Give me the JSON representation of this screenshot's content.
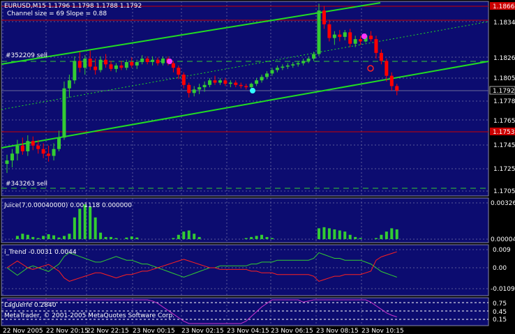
{
  "colors": {
    "background": "#000000",
    "plot_bg": "#0c0c70",
    "bull": "#33cc33",
    "bear": "#ff0000",
    "channel": "#22dd22",
    "hline": "#cc0000",
    "juice": "#33cc33",
    "trend_green": "#33cc33",
    "trend_red": "#ff2020",
    "laguerre": "#cc33cc"
  },
  "main": {
    "header_line1": "EURUSD,M15  1.1796 1.1798 1.1788 1.1792",
    "header_line2": "Channel size = 69 Slope = 0.88",
    "label_sell1": "#352209 sell",
    "label_sell2": "#343263 sell",
    "price_ticks": [
      "1.1834",
      "1.1805",
      "1.1778",
      "1.1765",
      "1.1745",
      "1.1725",
      "1.1705"
    ],
    "tag_top": "1.1866",
    "tag_current": "1.1792",
    "tag_low": "1.1753"
  },
  "juice": {
    "label": "Juice(7,0.00040000) 0.001118 0.000000",
    "ticks": [
      "0.00326",
      "0.00004"
    ]
  },
  "itrend": {
    "label": "i_Trend -0.0031 0.0044",
    "ticks": [
      "0.009",
      "0.00",
      "-0.0109"
    ]
  },
  "laguerre": {
    "label": "Laguerre 0.2840",
    "ticks": [
      "0.75",
      "0.45",
      "0.15"
    ],
    "copyright": "MetaTrader, © 2001-2005 MetaQuotes Software Corp."
  },
  "time_axis": [
    "22 Nov 2005",
    "22 Nov 20:15",
    "22 Nov 22:15",
    "23 Nov 00:15",
    "23 Nov 02:15",
    "23 Nov 04:15",
    "23 Nov 06:15",
    "23 Nov 08:15",
    "23 Nov 10:15"
  ],
  "chart_data": {
    "type": "candlestick",
    "symbol": "EURUSD",
    "timeframe": "M15",
    "ylim": [
      1.17,
      1.187
    ],
    "candles": [
      [
        1.1728,
        1.1736,
        1.172,
        1.1731
      ],
      [
        1.1731,
        1.1741,
        1.1725,
        1.1737
      ],
      [
        1.1737,
        1.1749,
        1.1731,
        1.1744
      ],
      [
        1.1744,
        1.1751,
        1.1736,
        1.1739
      ],
      [
        1.1739,
        1.1753,
        1.1735,
        1.1748
      ],
      [
        1.1748,
        1.1752,
        1.174,
        1.1744
      ],
      [
        1.1744,
        1.1749,
        1.1737,
        1.1741
      ],
      [
        1.1741,
        1.1746,
        1.1733,
        1.1737
      ],
      [
        1.1737,
        1.1744,
        1.173,
        1.1735
      ],
      [
        1.1735,
        1.1746,
        1.1731,
        1.1741
      ],
      [
        1.1741,
        1.1757,
        1.1739,
        1.1751
      ],
      [
        1.1751,
        1.18,
        1.1749,
        1.1794
      ],
      [
        1.1794,
        1.1806,
        1.1786,
        1.1801
      ],
      [
        1.1801,
        1.1822,
        1.1798,
        1.1818
      ],
      [
        1.1818,
        1.1826,
        1.1808,
        1.1812
      ],
      [
        1.1812,
        1.1823,
        1.1806,
        1.182
      ],
      [
        1.182,
        1.1827,
        1.181,
        1.1813
      ],
      [
        1.1813,
        1.182,
        1.1806,
        1.181
      ],
      [
        1.181,
        1.1822,
        1.1808,
        1.1819
      ],
      [
        1.1819,
        1.1824,
        1.1812,
        1.1815
      ],
      [
        1.1815,
        1.1818,
        1.1809,
        1.1811
      ],
      [
        1.1811,
        1.1816,
        1.1808,
        1.1814
      ],
      [
        1.1814,
        1.1818,
        1.181,
        1.1812
      ],
      [
        1.1812,
        1.1819,
        1.181,
        1.1817
      ],
      [
        1.1817,
        1.1821,
        1.1812,
        1.1814
      ],
      [
        1.1814,
        1.1819,
        1.1811,
        1.1817
      ],
      [
        1.1817,
        1.1823,
        1.1815,
        1.182
      ],
      [
        1.182,
        1.1822,
        1.1815,
        1.1817
      ],
      [
        1.1817,
        1.1822,
        1.1814,
        1.1819
      ],
      [
        1.1819,
        1.1821,
        1.1814,
        1.1816
      ],
      [
        1.1816,
        1.1822,
        1.1814,
        1.182
      ],
      [
        1.182,
        1.1822,
        1.1814,
        1.1816
      ],
      [
        1.1816,
        1.1818,
        1.1808,
        1.1812
      ],
      [
        1.1812,
        1.1814,
        1.1802,
        1.1806
      ],
      [
        1.1806,
        1.1808,
        1.1794,
        1.1797
      ],
      [
        1.1797,
        1.1799,
        1.1786,
        1.179
      ],
      [
        1.179,
        1.1796,
        1.1787,
        1.1793
      ],
      [
        1.1793,
        1.1798,
        1.1789,
        1.1795
      ],
      [
        1.1795,
        1.18,
        1.1791,
        1.1797
      ],
      [
        1.1797,
        1.1803,
        1.1795,
        1.1801
      ],
      [
        1.1801,
        1.1805,
        1.1797,
        1.1799
      ],
      [
        1.1799,
        1.1803,
        1.1797,
        1.1801
      ],
      [
        1.1801,
        1.1803,
        1.1796,
        1.1798
      ],
      [
        1.1798,
        1.1801,
        1.1795,
        1.1799
      ],
      [
        1.1799,
        1.1801,
        1.1795,
        1.1797
      ],
      [
        1.1797,
        1.1799,
        1.1794,
        1.1796
      ],
      [
        1.1796,
        1.1798,
        1.1793,
        1.1795
      ],
      [
        1.1795,
        1.1799,
        1.1794,
        1.1798
      ],
      [
        1.1798,
        1.1803,
        1.1796,
        1.1801
      ],
      [
        1.1801,
        1.1806,
        1.1799,
        1.1804
      ],
      [
        1.1804,
        1.1809,
        1.1802,
        1.1807
      ],
      [
        1.1807,
        1.1812,
        1.1805,
        1.181
      ],
      [
        1.181,
        1.1814,
        1.1808,
        1.1812
      ],
      [
        1.1812,
        1.1815,
        1.181,
        1.1813
      ],
      [
        1.1813,
        1.1816,
        1.1811,
        1.1814
      ],
      [
        1.1814,
        1.1817,
        1.1812,
        1.1815
      ],
      [
        1.1815,
        1.1818,
        1.1813,
        1.1816
      ],
      [
        1.1816,
        1.182,
        1.1814,
        1.1818
      ],
      [
        1.1818,
        1.1822,
        1.1816,
        1.182
      ],
      [
        1.182,
        1.1826,
        1.1818,
        1.1824
      ],
      [
        1.1824,
        1.1868,
        1.1822,
        1.1862
      ],
      [
        1.1862,
        1.1866,
        1.1846,
        1.185
      ],
      [
        1.185,
        1.1854,
        1.1835,
        1.1838
      ],
      [
        1.1838,
        1.1844,
        1.1832,
        1.1841
      ],
      [
        1.1841,
        1.1845,
        1.1835,
        1.1839
      ],
      [
        1.1839,
        1.1845,
        1.1836,
        1.1843
      ],
      [
        1.1843,
        1.1846,
        1.183,
        1.1833
      ],
      [
        1.1833,
        1.184,
        1.183,
        1.1837
      ],
      [
        1.1837,
        1.184,
        1.1832,
        1.1835
      ],
      [
        1.1835,
        1.1842,
        1.1834,
        1.184
      ],
      [
        1.184,
        1.1844,
        1.1835,
        1.1837
      ],
      [
        1.1837,
        1.184,
        1.182,
        1.1825
      ],
      [
        1.1825,
        1.1828,
        1.1815,
        1.1818
      ],
      [
        1.1818,
        1.182,
        1.18,
        1.1805
      ],
      [
        1.1805,
        1.1808,
        1.1792,
        1.1796
      ],
      [
        1.1796,
        1.1798,
        1.1788,
        1.1792
      ]
    ]
  }
}
